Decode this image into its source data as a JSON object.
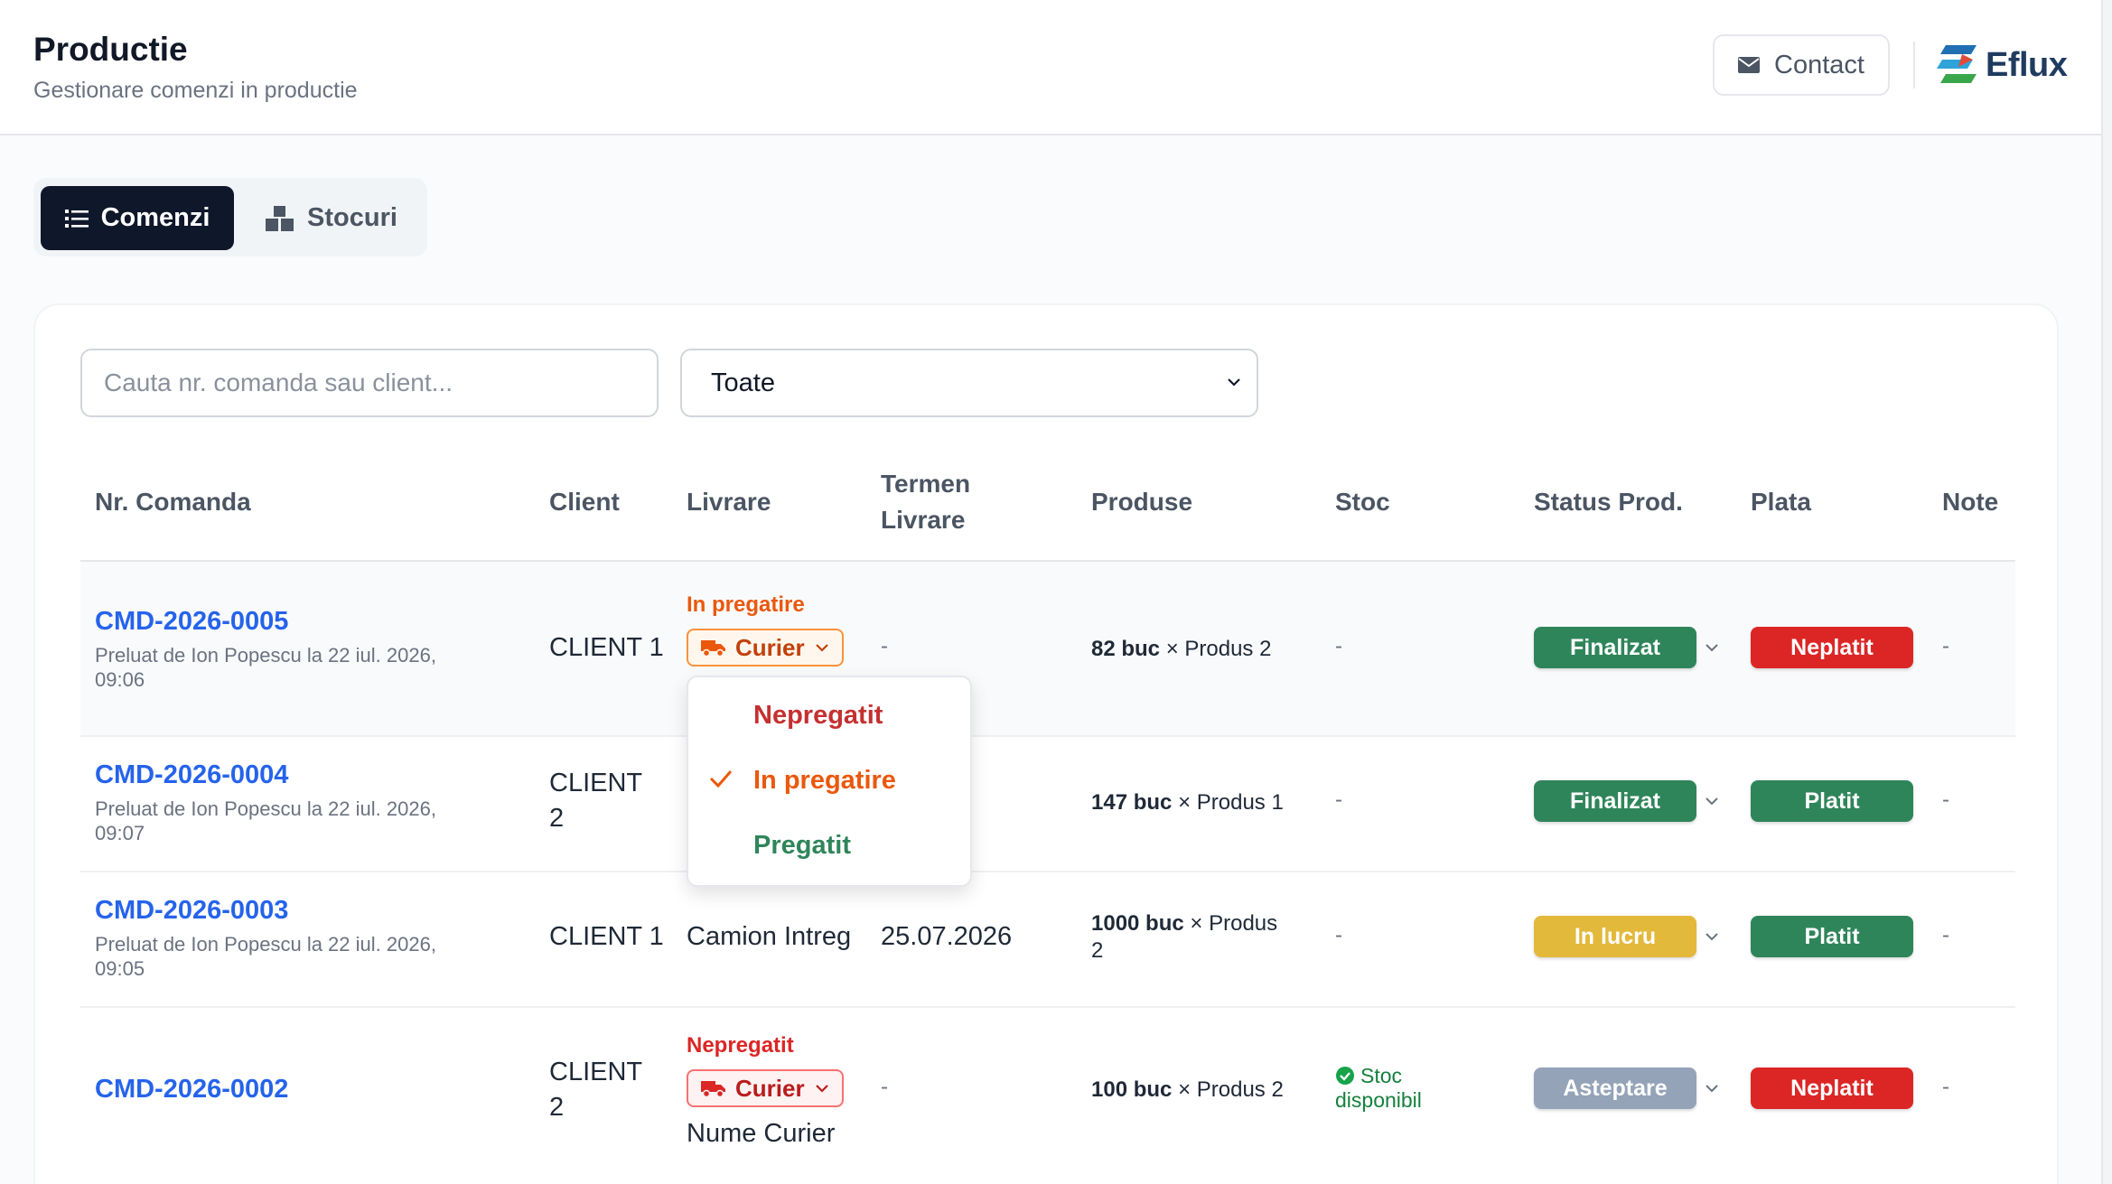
{
  "header": {
    "title": "Productie",
    "subtitle": "Gestionare comenzi in productie",
    "contact_label": "Contact",
    "contact_icon": "mail-icon",
    "logo_text": "Eflux"
  },
  "tabs": [
    {
      "label": "Comenzi",
      "icon": "list-icon",
      "active": true
    },
    {
      "label": "Stocuri",
      "icon": "boxes-icon",
      "active": false
    }
  ],
  "filters": {
    "search_placeholder": "Cauta nr. comanda sau client...",
    "status_selected": "Toate"
  },
  "columns": {
    "order": "Nr. Comanda",
    "client": "Client",
    "delivery": "Livrare",
    "deadline_line1": "Termen",
    "deadline_line2": "Livrare",
    "products": "Produse",
    "stock": "Stoc",
    "status": "Status Prod.",
    "payment": "Plata",
    "notes": "Note"
  },
  "colors": {
    "accent_blue": "#2563eb",
    "green": "#2f855a",
    "red": "#dc2626",
    "yellow": "#e2b93b",
    "gray": "#94a3b8",
    "orange": "#ea580c",
    "dark": "#0f172a"
  },
  "rows": [
    {
      "id": "CMD-2026-0005",
      "meta_line1": "Preluat de Ion Popescu la 22 iul. 2026,",
      "meta_line2": "09:06",
      "client": "CLIENT 1",
      "prep_status": "In pregatire",
      "courier": "Curier",
      "deadline": "-",
      "qty": "82 buc",
      "product": "× Produs 2",
      "stock": "-",
      "status": "Finalizat",
      "payment": "Neplatit",
      "notes": "-"
    },
    {
      "id": "CMD-2026-0004",
      "meta_line1": "Preluat de Ion Popescu la 22 iul. 2026,",
      "meta_line2": "09:07",
      "client_line1": "CLIENT",
      "client_line2": "2",
      "qty": "147 buc",
      "product": "× Produs 1",
      "stock": "-",
      "status": "Finalizat",
      "payment": "Platit",
      "notes": "-"
    },
    {
      "id": "CMD-2026-0003",
      "meta_line1": "Preluat de Ion Popescu la 22 iul. 2026,",
      "meta_line2": "09:05",
      "client": "CLIENT 1",
      "delivery": "Camion Intreg",
      "deadline": "25.07.2026",
      "qty": "1000 buc",
      "product_line1": "× Produs",
      "product_line2": "2",
      "stock": "-",
      "status": "In lucru",
      "payment": "Platit",
      "notes": "-"
    },
    {
      "id": "CMD-2026-0002",
      "client_line1": "CLIENT",
      "client_line2": "2",
      "prep_status": "Nepregatit",
      "courier": "Curier",
      "courier_name": "Nume Curier",
      "deadline": "-",
      "qty": "100 buc",
      "product": "× Produs 2",
      "stock_line1": "Stoc",
      "stock_line2": "disponibil",
      "status": "Asteptare",
      "payment": "Neplatit",
      "notes": "-"
    }
  ],
  "prep_dropdown": {
    "options": [
      "Nepregatit",
      "In pregatire",
      "Pregatit"
    ],
    "selected": "In pregatire"
  }
}
